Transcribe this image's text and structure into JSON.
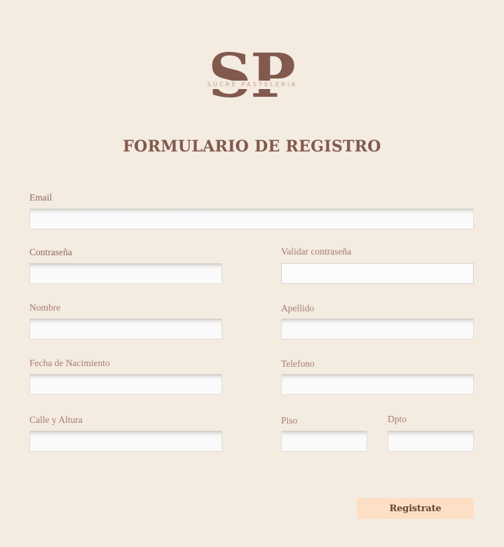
{
  "logo": {
    "monogram": "SP",
    "tagline": "SUCRÉ PASTELERIA"
  },
  "form": {
    "title": "FORMULARIO DE REGISTRO",
    "fields": {
      "email": {
        "label": "Email",
        "value": ""
      },
      "password": {
        "label": "Contraseña",
        "value": ""
      },
      "confirm_password": {
        "label": "Validar contraseña",
        "value": ""
      },
      "first_name": {
        "label": "Nombre",
        "value": ""
      },
      "last_name": {
        "label": "Apellido",
        "value": ""
      },
      "birth_date": {
        "label": "Fecha de Nacimiento",
        "value": ""
      },
      "phone": {
        "label": "Telefono",
        "value": ""
      },
      "street": {
        "label": "Calle y Altura",
        "value": ""
      },
      "floor": {
        "label": "Piso",
        "value": ""
      },
      "apartment": {
        "label": "Dpto",
        "value": ""
      }
    },
    "submit_label": "Registrate"
  },
  "colors": {
    "background": "#f4ebe1",
    "brand_brown": "#82594d",
    "label_brown": "#a57d70",
    "button_peach": "#fcdfc4"
  }
}
